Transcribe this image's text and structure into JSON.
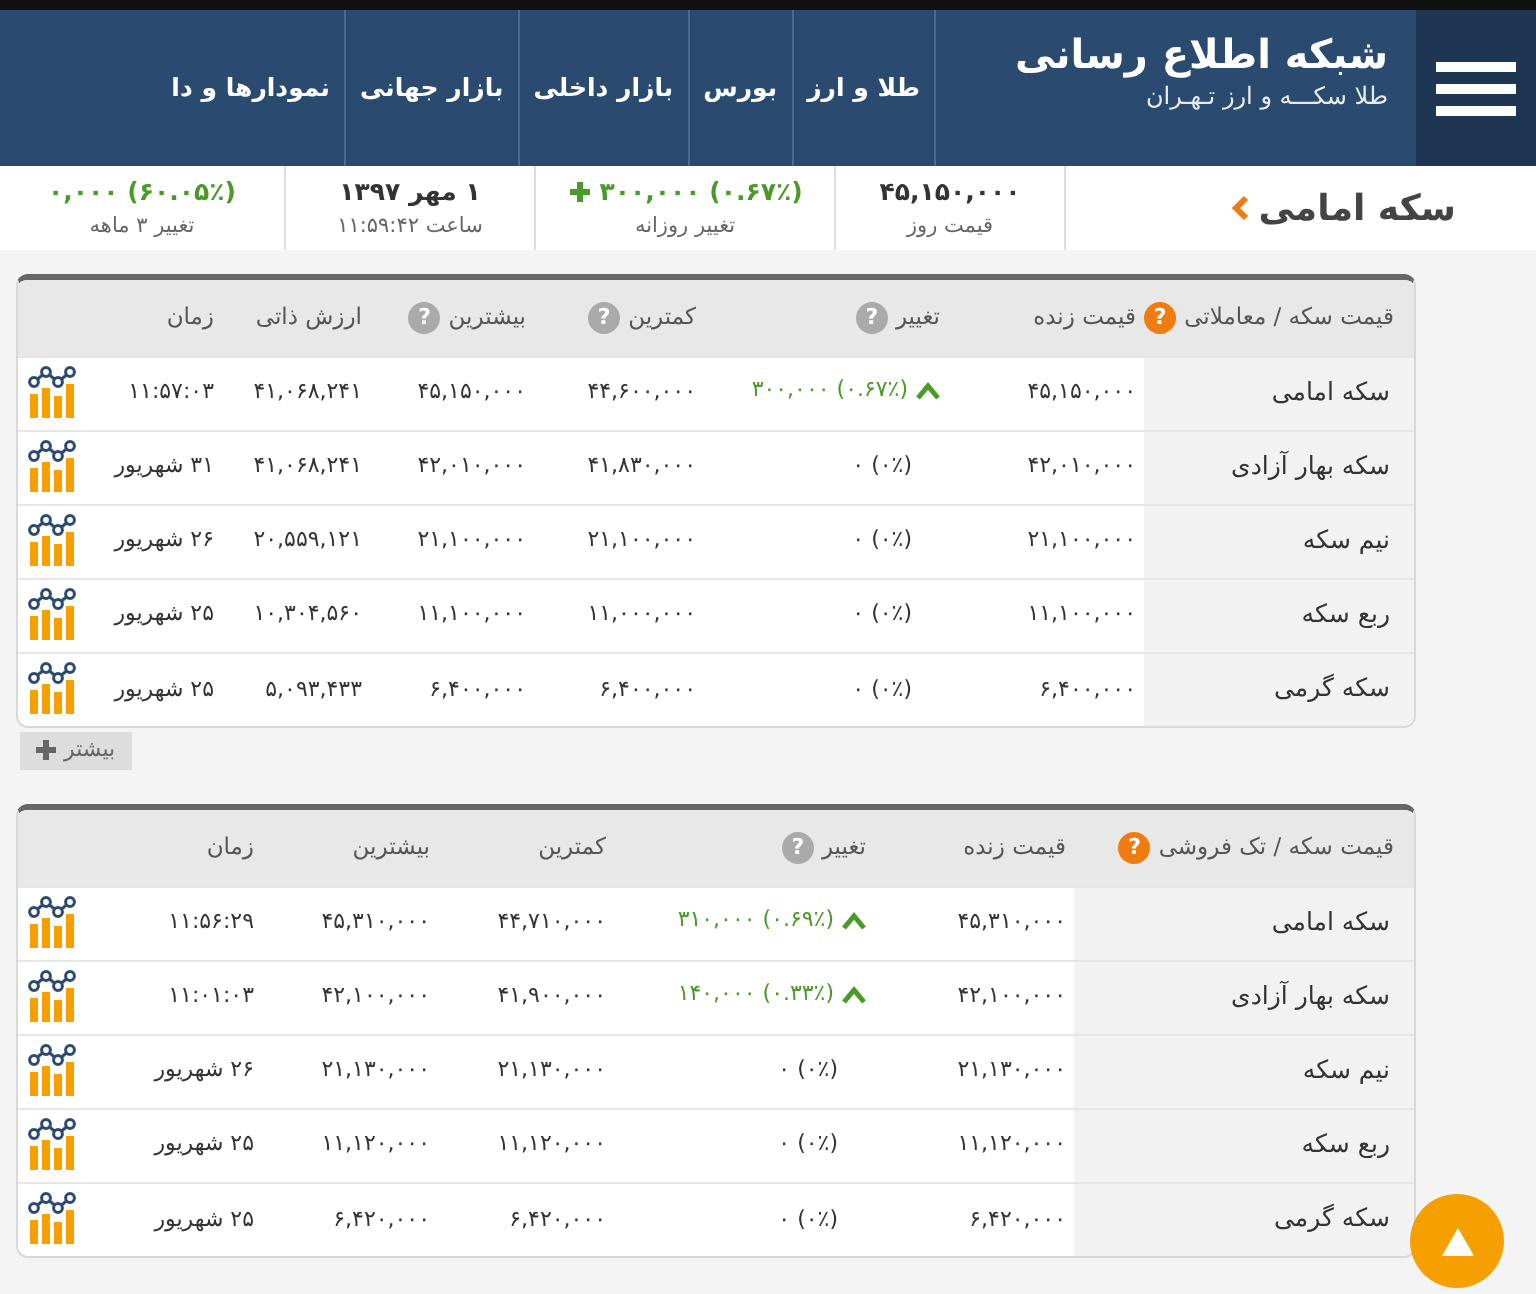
{
  "header": {
    "brand_title": "شبکه اطلاع رسانی",
    "brand_subtitle": "طلا سکـــه و ارز تـهـران",
    "nav": [
      "طلا و ارز",
      "بورس",
      "بازار داخلی",
      "بازار جهانی",
      "نمودارها و دا"
    ]
  },
  "summary": {
    "title": "سکه امامی",
    "stats": [
      {
        "kind": "price",
        "value": "۴۵,۱۵۰,۰۰۰",
        "label": "قیمت روز"
      },
      {
        "kind": "change",
        "rising": true,
        "value": "(۰.۶۷٪) ۳۰۰,۰۰۰",
        "label": "تغییر روزانه"
      },
      {
        "kind": "date",
        "value": "۱ مهر ۱۳۹۷",
        "label": "ساعت ۱۱:۵۹:۴۲"
      },
      {
        "kind": "change",
        "value": "(۶۰.۰۵٪) ۰,۰۰۰",
        "label": "تغییر ۳ ماهه"
      }
    ]
  },
  "tables": [
    {
      "columns": [
        {
          "label": "قیمت سکه / معاملاتی",
          "help": "?"
        },
        {
          "label": "قیمت زنده"
        },
        {
          "label": "تغییر",
          "help": "?"
        },
        {
          "label": "کمترین",
          "help": "?"
        },
        {
          "label": "بیشترین",
          "help": "?"
        },
        {
          "label": "ارزش ذاتی"
        },
        {
          "label": "زمان"
        }
      ],
      "rows": [
        {
          "rising": true,
          "cells": [
            "سکه امامی",
            "۴۵,۱۵۰,۰۰۰",
            "(۰.۶۷٪) ۳۰۰,۰۰۰",
            "۴۴,۶۰۰,۰۰۰",
            "۴۵,۱۵۰,۰۰۰",
            "۴۱,۰۶۸,۲۴۱",
            "۱۱:۵۷:۰۳"
          ]
        },
        {
          "rising": false,
          "cells": [
            "سکه بهار آزادی",
            "۴۲,۰۱۰,۰۰۰",
            "(۰٪) ۰",
            "۴۱,۸۳۰,۰۰۰",
            "۴۲,۰۱۰,۰۰۰",
            "۴۱,۰۶۸,۲۴۱",
            "۳۱ شهریور"
          ]
        },
        {
          "rising": false,
          "cells": [
            "نیم سکه",
            "۲۱,۱۰۰,۰۰۰",
            "(۰٪) ۰",
            "۲۱,۱۰۰,۰۰۰",
            "۲۱,۱۰۰,۰۰۰",
            "۲۰,۵۵۹,۱۲۱",
            "۲۶ شهریور"
          ]
        },
        {
          "rising": false,
          "cells": [
            "ربع سکه",
            "۱۱,۱۰۰,۰۰۰",
            "(۰٪) ۰",
            "۱۱,۰۰۰,۰۰۰",
            "۱۱,۱۰۰,۰۰۰",
            "۱۰,۳۰۴,۵۶۰",
            "۲۵ شهریور"
          ]
        },
        {
          "rising": false,
          "cells": [
            "سکه گرمی",
            "۶,۴۰۰,۰۰۰",
            "(۰٪) ۰",
            "۶,۴۰۰,۰۰۰",
            "۶,۴۰۰,۰۰۰",
            "۵,۰۹۳,۴۳۳",
            "۲۵ شهریور"
          ]
        }
      ],
      "more_button": "بیشتر"
    },
    {
      "columns": [
        {
          "label": "قیمت سکه / تک فروشی",
          "help": "?"
        },
        {
          "label": "قیمت زنده"
        },
        {
          "label": "تغییر",
          "help": "?"
        },
        {
          "label": "کمترین"
        },
        {
          "label": "بیشترین"
        },
        {
          "label": "زمان"
        }
      ],
      "rows": [
        {
          "rising": true,
          "cells": [
            "سکه امامی",
            "۴۵,۳۱۰,۰۰۰",
            "(۰.۶۹٪) ۳۱۰,۰۰۰",
            "۴۴,۷۱۰,۰۰۰",
            "۴۵,۳۱۰,۰۰۰",
            "۱۱:۵۶:۲۹"
          ]
        },
        {
          "rising": true,
          "cells": [
            "سکه بهار آزادی",
            "۴۲,۱۰۰,۰۰۰",
            "(۰.۳۳٪) ۱۴۰,۰۰۰",
            "۴۱,۹۰۰,۰۰۰",
            "۴۲,۱۰۰,۰۰۰",
            "۱۱:۰۱:۰۳"
          ]
        },
        {
          "rising": false,
          "cells": [
            "نیم سکه",
            "۲۱,۱۳۰,۰۰۰",
            "(۰٪) ۰",
            "۲۱,۱۳۰,۰۰۰",
            "۲۱,۱۳۰,۰۰۰",
            "۲۶ شهریور"
          ]
        },
        {
          "rising": false,
          "cells": [
            "ربع سکه",
            "۱۱,۱۲۰,۰۰۰",
            "(۰٪) ۰",
            "۱۱,۱۲۰,۰۰۰",
            "۱۱,۱۲۰,۰۰۰",
            "۲۵ شهریور"
          ]
        },
        {
          "rising": false,
          "cells": [
            "سکه گرمی",
            "۶,۴۲۰,۰۰۰",
            "(۰٪) ۰",
            "۶,۴۲۰,۰۰۰",
            "۶,۴۲۰,۰۰۰",
            "۲۵ شهریور"
          ]
        }
      ]
    }
  ],
  "scroll_top_button": true
}
